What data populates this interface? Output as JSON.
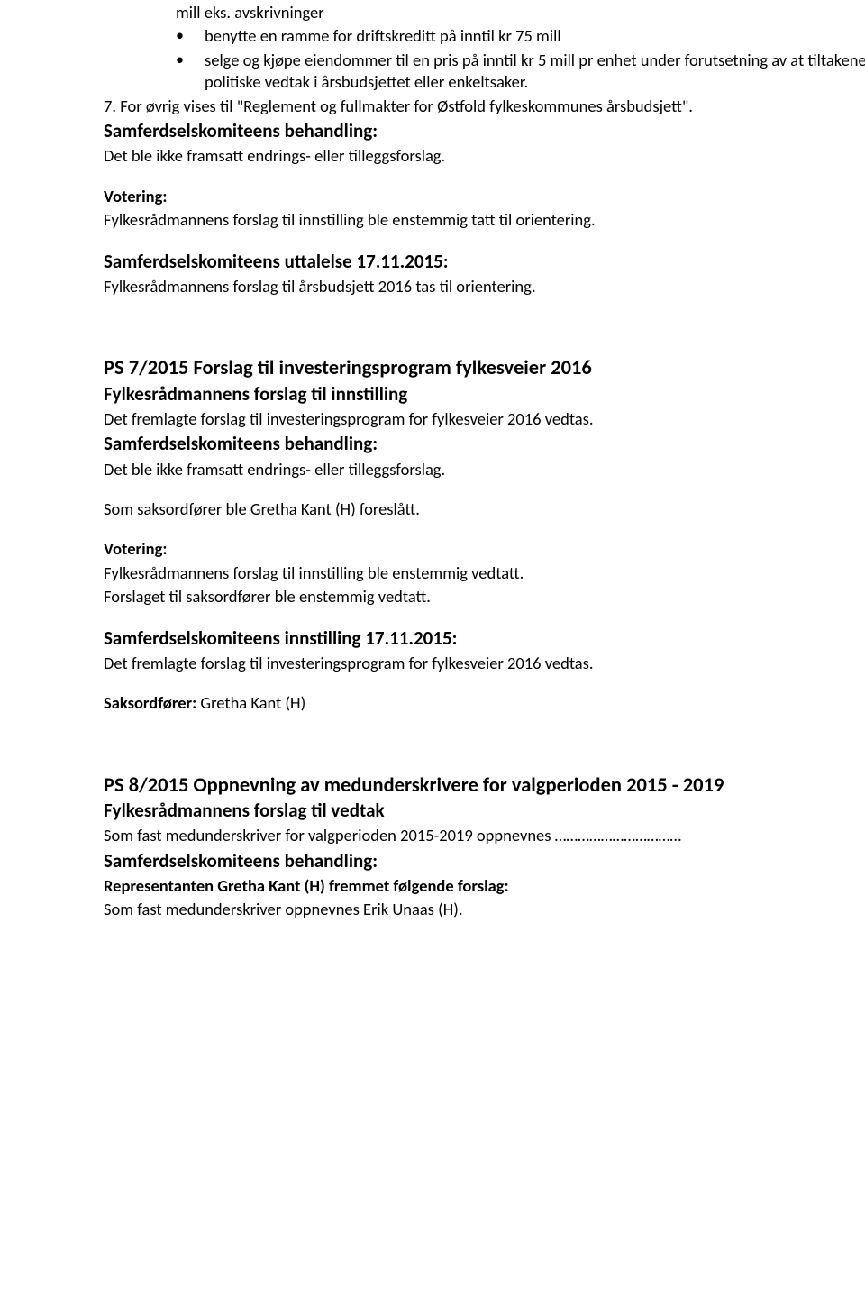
{
  "topIndent": {
    "line1": "mill eks. avskrivninger",
    "bullets": [
      "benytte en ramme for driftskreditt på inntil kr 75 mill",
      "selge og kjøpe eiendommer til en pris på inntil kr 5 mill pr enhet under forutsetning av at tiltakene er i tråd med politiske vedtak i årsbudsjettet eller enkeltsaker."
    ],
    "point7": "7. For øvrig vises til \"Reglement og fullmakter for Østfold fylkeskommunes årsbudsjett\"."
  },
  "sec1": {
    "behandlingLabel": "Samferdselskomiteens behandling:",
    "behandlingText": "Det ble ikke framsatt endrings- eller tilleggsforslag.",
    "voteringLabel": "Votering:",
    "voteringText": "Fylkesrådmannens forslag til innstilling ble enstemmig tatt til orientering.",
    "uttalelseHeading": "Samferdselskomiteens uttalelse 17.11.2015:",
    "uttalelseText": "Fylkesrådmannens forslag til årsbudsjett 2016 tas til orientering."
  },
  "sec2": {
    "title": "PS 7/2015 Forslag til investeringsprogram fylkesveier 2016",
    "innstillingHeading": "Fylkesrådmannens forslag til innstilling",
    "innstillingText": "Det fremlagte forslag til investeringsprogram for fylkesveier 2016 vedtas.",
    "behandlingLabel": "Samferdselskomiteens behandling:",
    "behandlingText": "Det ble ikke framsatt endrings- eller tilleggsforslag.",
    "saksordforer": "Som saksordfører ble Gretha Kant (H) foreslått.",
    "voteringLabel": "Votering:",
    "voteringText1": "Fylkesrådmannens forslag til innstilling ble enstemmig vedtatt.",
    "voteringText2": "Forslaget til saksordfører ble enstemmig vedtatt.",
    "innstilling2Heading": "Samferdselskomiteens innstilling 17.11.2015:",
    "innstilling2Text": "Det fremlagte forslag til investeringsprogram for fylkesveier 2016 vedtas.",
    "saksordforerLabel": "Saksordfører:",
    "saksordforerName": " Gretha Kant (H)"
  },
  "sec3": {
    "title": "PS 8/2015 Oppnevning av medunderskrivere for valgperioden 2015 - 2019",
    "vedtakHeading": "Fylkesrådmannens forslag til vedtak",
    "vedtakText": "Som fast medunderskriver for valgperioden 2015-2019 oppnevnes ……………………………",
    "behandlingLabel": "Samferdselskomiteens behandling:",
    "repLine": "Representanten Gretha Kant (H) fremmet følgende forslag:",
    "repText": "Som fast medunderskriver oppnevnes Erik Unaas (H)."
  }
}
